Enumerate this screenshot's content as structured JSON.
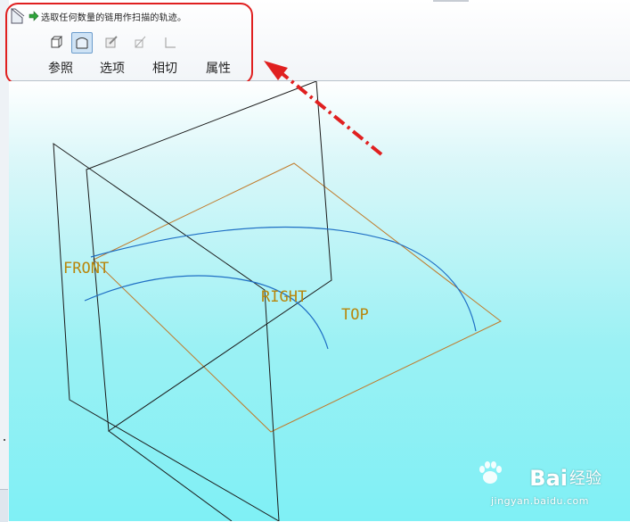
{
  "dashboard": {
    "message": "选取任何数量的链用作扫描的轨迹。",
    "tools": [
      {
        "name": "solid-icon",
        "active": false
      },
      {
        "name": "surface-icon",
        "active": true
      },
      {
        "name": "sketch-edit-icon",
        "active": false
      },
      {
        "name": "remove-material-icon",
        "active": false
      },
      {
        "name": "thicken-icon",
        "active": false
      }
    ],
    "tabs": [
      {
        "label": "参照"
      },
      {
        "label": "选项"
      },
      {
        "label": "相切"
      },
      {
        "label": "属性"
      }
    ]
  },
  "viewport": {
    "datum_planes": {
      "front": "FRONT",
      "right": "RIGHT",
      "top": "TOP"
    }
  },
  "watermark": {
    "brand": "Bai",
    "brand_cn": "经验",
    "url": "jingyan.baidu.com"
  },
  "colors": {
    "annotation": "#e02020",
    "datum_plane_front_right": "#1a1a1a",
    "datum_plane_top": "#c07a2a",
    "trajectory": "#1f6fc4",
    "datum_label": "#b8860b"
  }
}
